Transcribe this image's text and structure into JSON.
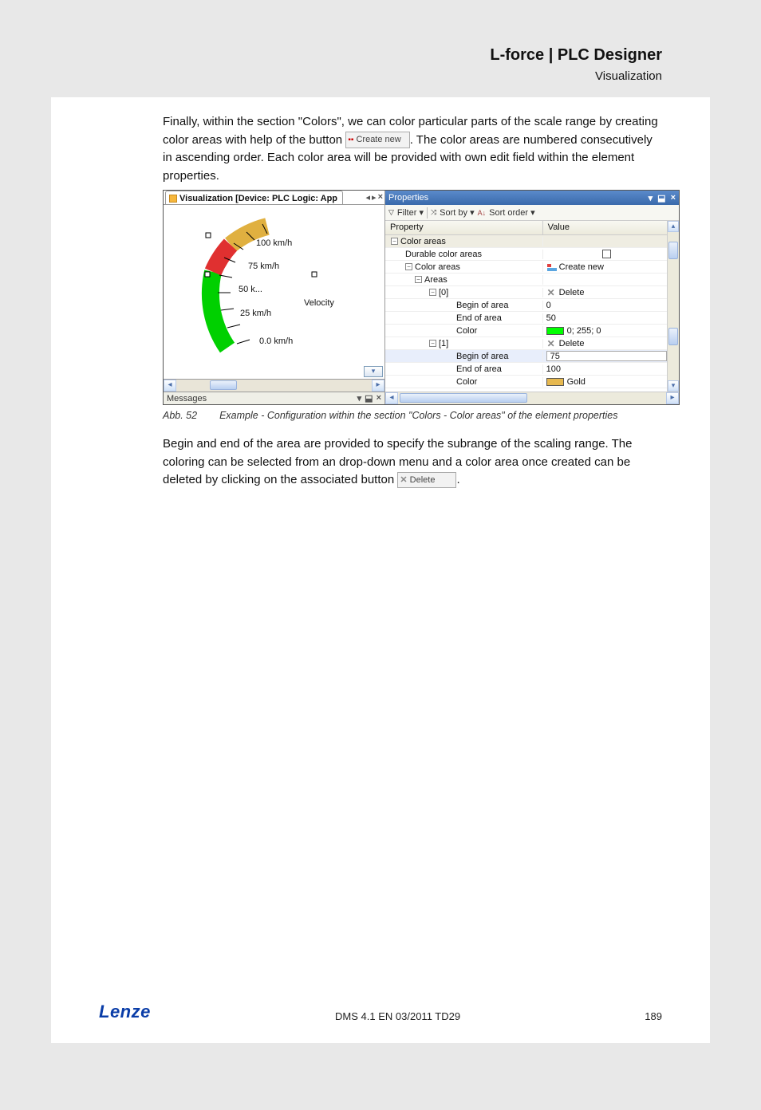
{
  "header": {
    "title": "L-force | PLC Designer",
    "sub": "Visualization"
  },
  "para1": "Finally, within the section \"Colors\",  we can color particular parts of the scale range by creating color areas with help of the button ",
  "btn_create_inline": "Create new",
  "para1b": ". The color areas are numbered consecutively in ascending order. Each color area will be provided with own edit field within the element properties.",
  "fig": {
    "tab_title": "Visualization [Device: PLC Logic: App",
    "gauge": {
      "l0": "0.0 km/h",
      "l25": "25 km/h",
      "l50": "50 k...",
      "l75": "75 km/h",
      "l100": "100 km/h",
      "label": "Velocity"
    },
    "messages_label": "Messages",
    "prop_title": "Properties",
    "tools": {
      "filter": "Filter",
      "sortby": "Sort by",
      "sortorder": "Sort order"
    },
    "col_prop": "Property",
    "col_val": "Value",
    "rows": {
      "color_areas": "Color areas",
      "durable": "Durable color areas",
      "color_areas2": "Color areas",
      "create_new": "Create new",
      "areas": "Areas",
      "a0": "[0]",
      "a0_begin_lbl": "Begin of area",
      "a0_begin_val": "0",
      "a0_end_lbl": "End of area",
      "a0_end_val": "50",
      "a0_color_lbl": "Color",
      "a0_color_val": "0; 255; 0",
      "delete": "Delete",
      "a1": "[1]",
      "a1_begin_lbl": "Begin of area",
      "a1_begin_val": "75",
      "a1_end_lbl": "End of area",
      "a1_end_val": "100",
      "a1_color_lbl": "Color",
      "a1_color_val": "Gold"
    }
  },
  "caption": {
    "id": "Abb. 52",
    "text": "Example - Configuration within the section \"Colors - Color areas\" of the element properties"
  },
  "para2": "Begin and end of the area are provided to specify the subrange of the scaling range. The coloring can be selected from an drop-down menu and a color area once created can be deleted by clicking on the associated button ",
  "btn_delete_inline": "Delete",
  "para2b": ".",
  "footer": {
    "brand": "Lenze",
    "center": "DMS 4.1 EN 03/2011 TD29",
    "page": "189"
  }
}
